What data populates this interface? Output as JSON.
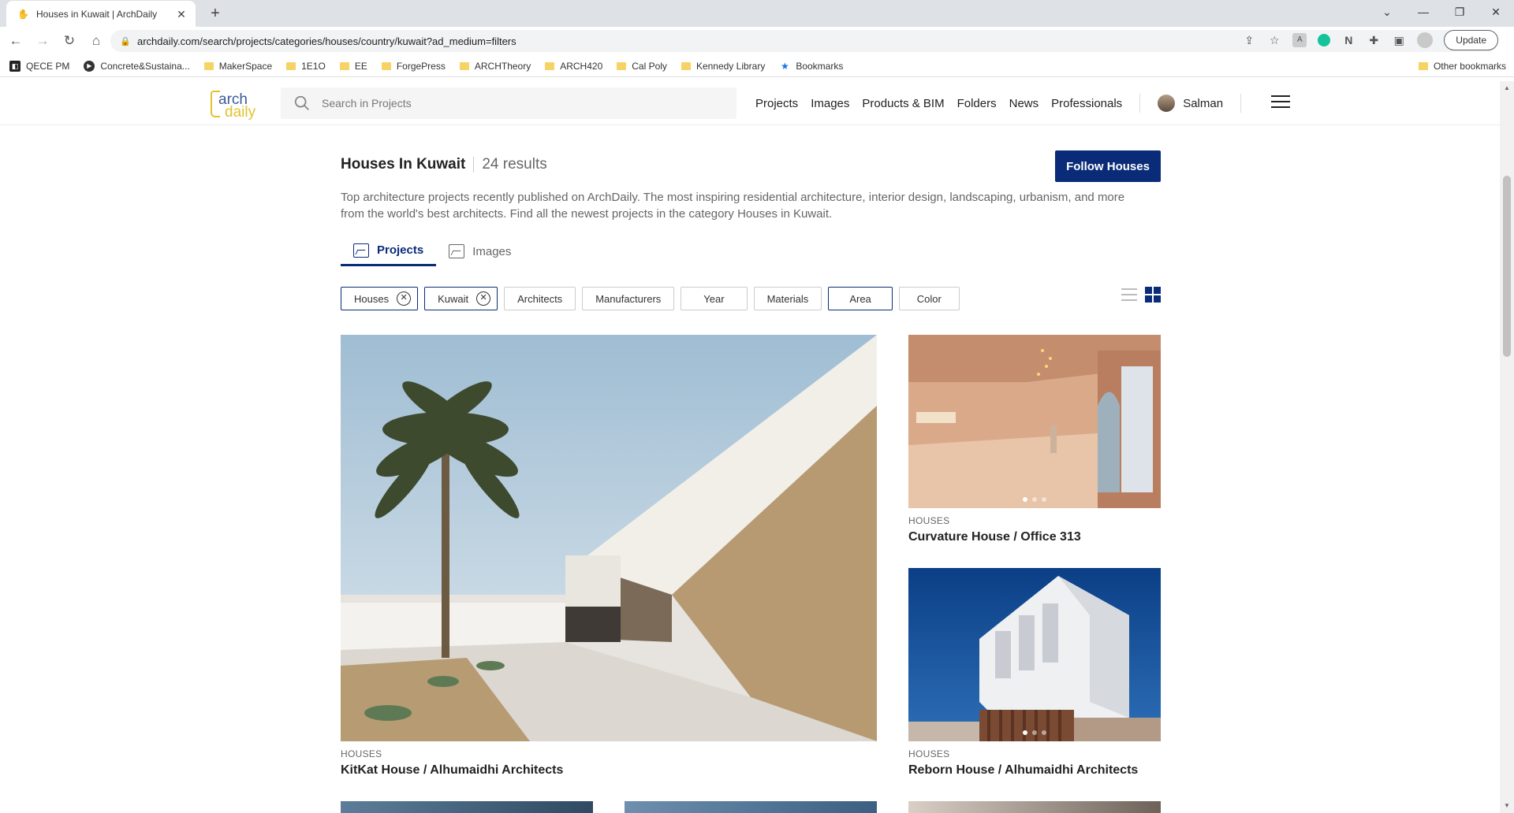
{
  "browser": {
    "tab_title": "Houses in Kuwait | ArchDaily",
    "url": "archdaily.com/search/projects/categories/houses/country/kuwait?ad_medium=filters",
    "update_label": "Update"
  },
  "bookmarks": {
    "items": [
      "QECE PM",
      "Concrete&Sustaina...",
      "MakerSpace",
      "1E1O",
      "EE",
      "ForgePress",
      "ARCHTheory",
      "ARCH420",
      "Cal Poly",
      "Kennedy Library",
      "Bookmarks"
    ],
    "other": "Other bookmarks"
  },
  "site": {
    "logo_line1": "arch",
    "logo_line2": "daily",
    "search_placeholder": "Search in Projects",
    "nav": [
      "Projects",
      "Images",
      "Products & BIM",
      "Folders",
      "News",
      "Professionals"
    ],
    "user_name": "Salman"
  },
  "page": {
    "title": "Houses In Kuwait",
    "result_count": "24 results",
    "follow_label": "Follow Houses",
    "description": "Top architecture projects recently published on ArchDaily. The most inspiring residential architecture, interior design, landscaping, urbanism, and more from the world's best architects. Find all the newest projects in the category Houses in Kuwait.",
    "tabs": [
      "Projects",
      "Images"
    ]
  },
  "filters": {
    "selected": [
      "Houses",
      "Kuwait"
    ],
    "options": [
      "Architects",
      "Manufacturers",
      "Year",
      "Materials",
      "Area",
      "Color"
    ]
  },
  "projects": [
    {
      "category": "HOUSES",
      "title": "KitKat House / Alhumaidhi Architects"
    },
    {
      "category": "HOUSES",
      "title": "Curvature House / Office 313"
    },
    {
      "category": "HOUSES",
      "title": "Reborn House / Alhumaidhi Architects"
    }
  ],
  "colors": {
    "accent": "#0a2b77",
    "logo_blue": "#3b5998",
    "logo_yellow": "#e2c22f"
  }
}
